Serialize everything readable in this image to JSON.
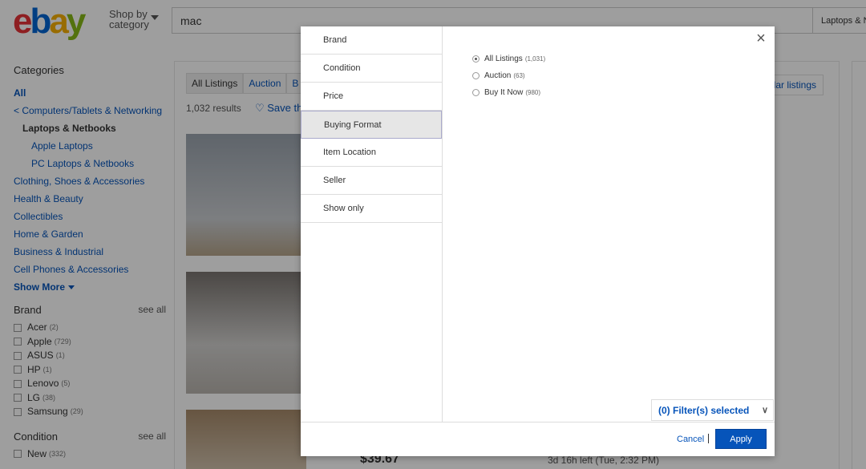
{
  "header": {
    "logo": {
      "l1": "e",
      "l2": "b",
      "l3": "a",
      "l4": "y"
    },
    "shop_by_line1": "Shop by",
    "shop_by_line2": "category",
    "search_value": "mac",
    "category_select": "Laptops & N"
  },
  "sidebar": {
    "categories_title": "Categories",
    "all_label": "All",
    "parent_label": "< Computers/Tablets & Networking",
    "current_label": "Laptops & Netbooks",
    "subcategories": [
      "Apple Laptops",
      "PC Laptops & Netbooks"
    ],
    "other_categories": [
      "Clothing, Shoes & Accessories",
      "Health & Beauty",
      "Collectibles",
      "Home & Garden",
      "Business & Industrial",
      "Cell Phones & Accessories"
    ],
    "show_more": "Show More",
    "brand": {
      "title": "Brand",
      "see_all": "see all",
      "items": [
        {
          "label": "Acer",
          "count": "(2)"
        },
        {
          "label": "Apple",
          "count": "(729)"
        },
        {
          "label": "ASUS",
          "count": "(1)"
        },
        {
          "label": "HP",
          "count": "(1)"
        },
        {
          "label": "Lenovo",
          "count": "(5)"
        },
        {
          "label": "LG",
          "count": "(38)"
        },
        {
          "label": "Samsung",
          "count": "(29)"
        }
      ]
    },
    "condition": {
      "title": "Condition",
      "see_all": "see all",
      "items": [
        {
          "label": "New",
          "count": "(332)"
        }
      ]
    }
  },
  "results": {
    "tabs": [
      "All Listings",
      "Auction",
      "B"
    ],
    "count": "1,032 results",
    "save_search": "♡ Save th",
    "similar": "ilar listings",
    "price": "$39.67",
    "time_left": "3d 16h left (Tue, 2:32 PM)"
  },
  "modal": {
    "nav": [
      "Brand",
      "Condition",
      "Price",
      "Buying Format",
      "Item Location",
      "Seller",
      "Show only"
    ],
    "selected_nav": "Buying Format",
    "close_icon": "×",
    "options": [
      {
        "label": "All Listings",
        "count": "(1,031)",
        "checked": true
      },
      {
        "label": "Auction",
        "count": "(63)",
        "checked": false
      },
      {
        "label": "Buy It Now",
        "count": "(980)",
        "checked": false
      }
    ],
    "filters_selected": "(0) Filter(s) selected",
    "cancel": "Cancel",
    "apply": "Apply"
  }
}
